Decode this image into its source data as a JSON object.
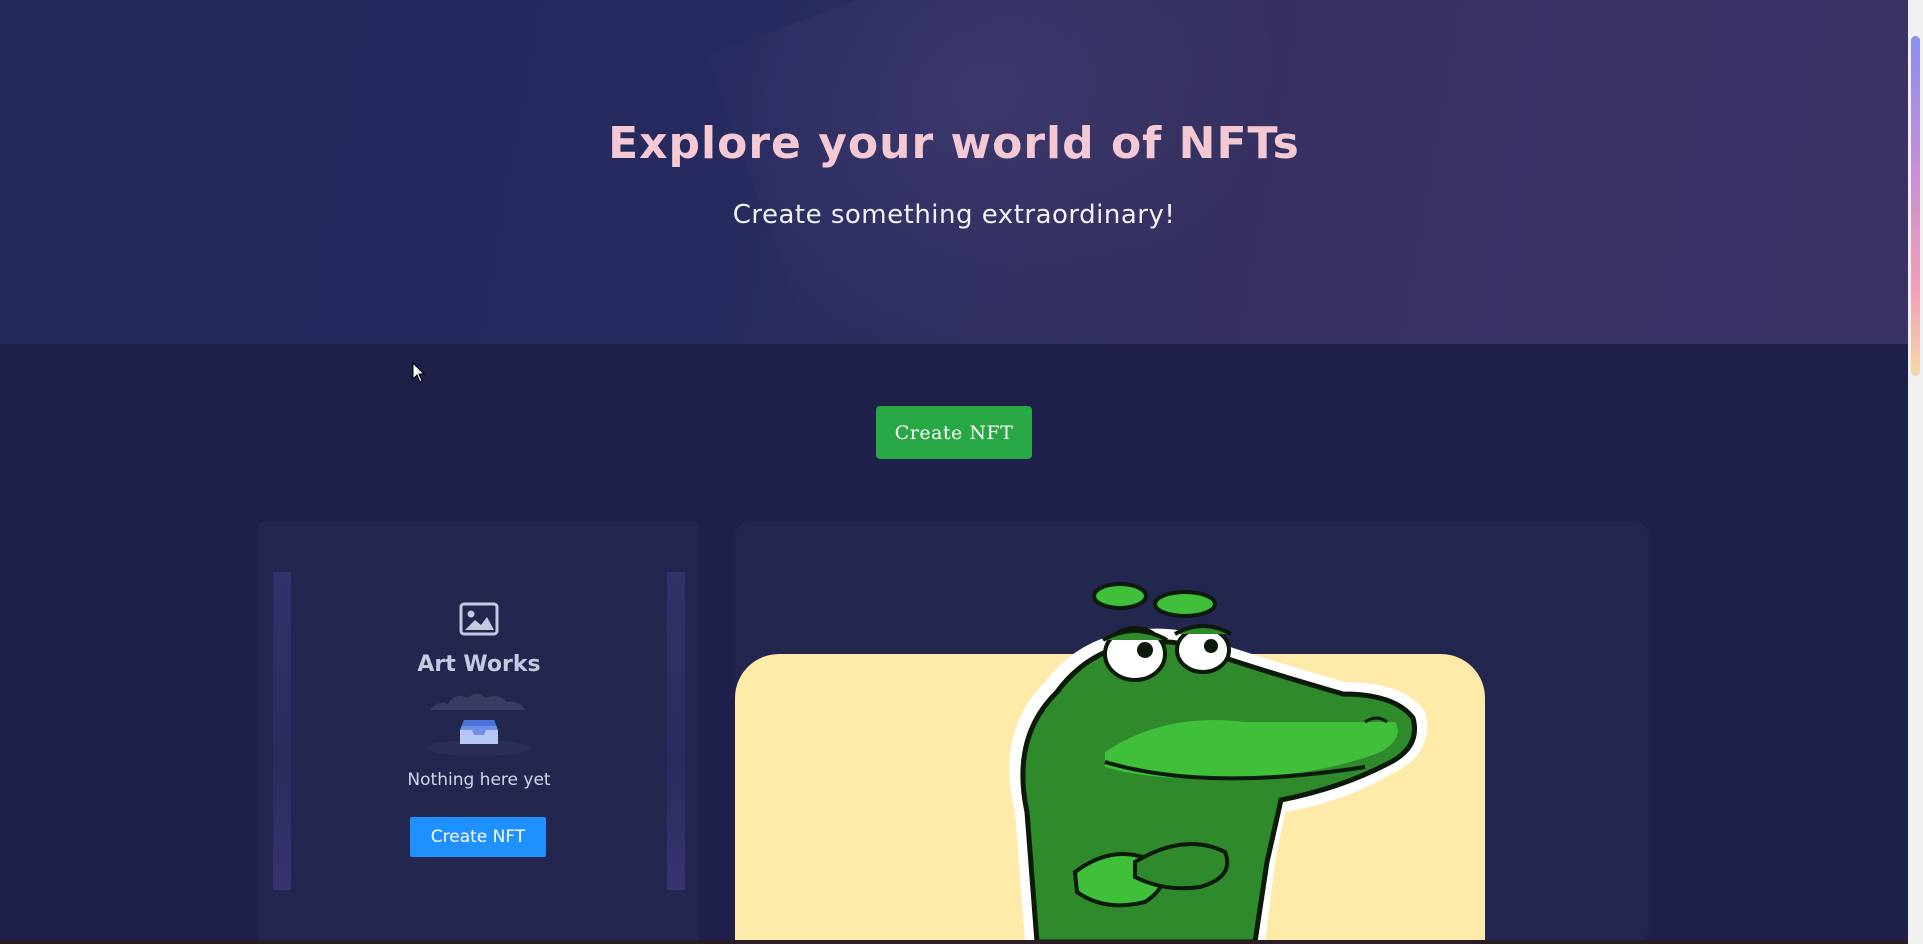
{
  "hero": {
    "title": "Explore your world of NFTs",
    "subtitle": "Create something extraordinary!"
  },
  "main": {
    "create_button_label": "Create NFT"
  },
  "artworks": {
    "icon": "image-icon",
    "title": "Art Works",
    "empty_illustration": "empty-inbox-icon",
    "empty_text": "Nothing here yet",
    "create_button_label": "Create NFT"
  },
  "showcase": {
    "image": "crocodile-mascot",
    "background_color": "#feeaa9"
  },
  "colors": {
    "hero_title": "#f4c9d3",
    "primary_green": "#28a745",
    "primary_blue": "#1e90ff",
    "background": "#1e2049"
  }
}
